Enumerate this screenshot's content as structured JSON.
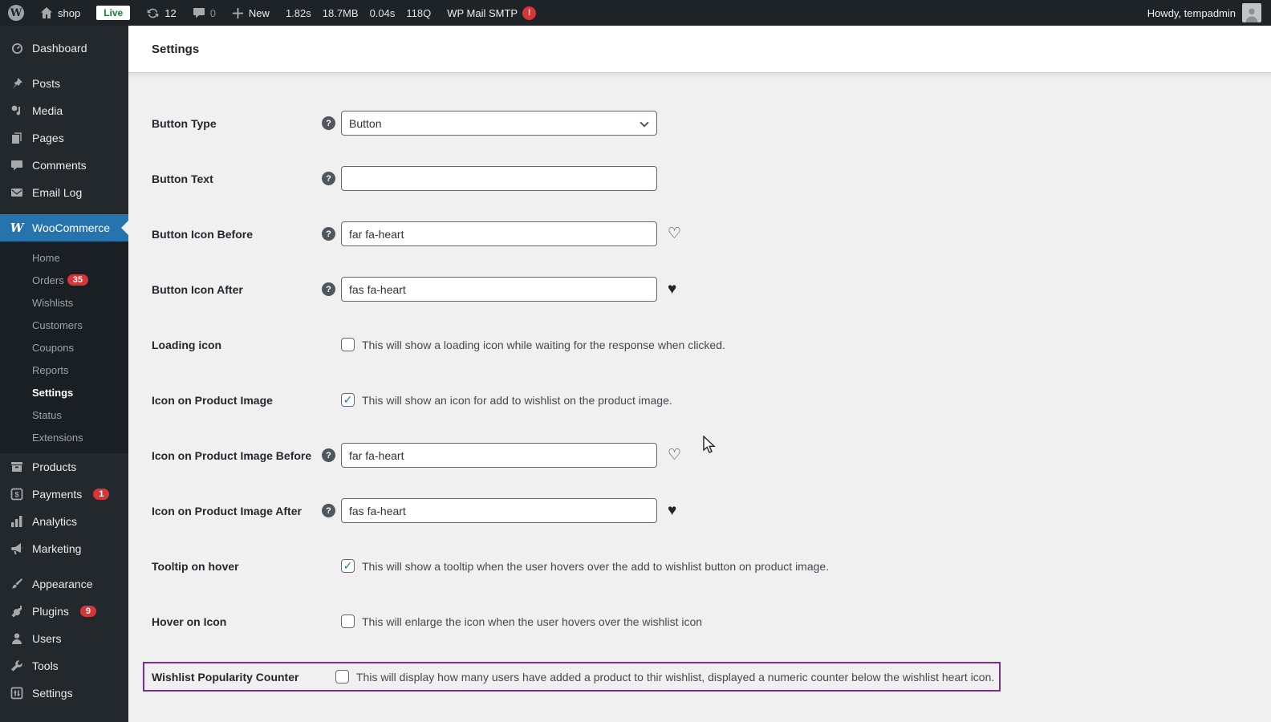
{
  "admin_bar": {
    "site_name": "shop",
    "live_badge": "Live",
    "updates_count": "12",
    "comments_count": "0",
    "new_label": "New",
    "stats": [
      "1.82s",
      "18.7MB",
      "0.04s",
      "118Q"
    ],
    "smtp_label": "WP Mail SMTP",
    "smtp_badge": "!",
    "howdy": "Howdy, tempadmin"
  },
  "sidebar": {
    "top": [
      {
        "label": "Dashboard"
      },
      {
        "label": "Posts"
      },
      {
        "label": "Media"
      },
      {
        "label": "Pages"
      },
      {
        "label": "Comments"
      },
      {
        "label": "Email Log"
      }
    ],
    "woocommerce": {
      "label": "WooCommerce",
      "w": "W"
    },
    "submenu": [
      {
        "label": "Home"
      },
      {
        "label": "Orders",
        "badge": "35"
      },
      {
        "label": "Wishlists"
      },
      {
        "label": "Customers"
      },
      {
        "label": "Coupons"
      },
      {
        "label": "Reports"
      },
      {
        "label": "Settings"
      },
      {
        "label": "Status"
      },
      {
        "label": "Extensions"
      }
    ],
    "bottom": [
      {
        "label": "Products"
      },
      {
        "label": "Payments",
        "badge": "1"
      },
      {
        "label": "Analytics"
      },
      {
        "label": "Marketing"
      },
      {
        "label": "Appearance"
      },
      {
        "label": "Plugins",
        "badge": "9"
      },
      {
        "label": "Users"
      },
      {
        "label": "Tools"
      },
      {
        "label": "Settings"
      }
    ]
  },
  "page": {
    "title": "Settings"
  },
  "icons": {
    "check": "✓",
    "heart_outline": "♡",
    "heart_solid": "♥",
    "help": "?"
  },
  "form": {
    "rows": [
      {
        "label": "Button Type",
        "type": "select",
        "value": "Button"
      },
      {
        "label": "Button Text",
        "type": "input",
        "value": ""
      },
      {
        "label": "Button Icon Before",
        "type": "input",
        "value": "far fa-heart"
      },
      {
        "label": "Button Icon After",
        "type": "input",
        "value": "fas fa-heart"
      },
      {
        "label": "Loading icon",
        "type": "checkbox",
        "checked": false,
        "desc": "This will show a loading icon while waiting for the response when clicked."
      },
      {
        "label": "Icon on Product Image",
        "type": "checkbox",
        "checked": true,
        "desc": "This will show an icon for add to wishlist on the product image."
      },
      {
        "label": "Icon on Product Image Before",
        "type": "input",
        "value": "far fa-heart"
      },
      {
        "label": "Icon on Product Image After",
        "type": "input",
        "value": "fas fa-heart"
      },
      {
        "label": "Tooltip on hover",
        "type": "checkbox",
        "checked": true,
        "desc": "This will show a tooltip when the user hovers over the add to wishlist button on product image."
      },
      {
        "label": "Hover on Icon",
        "type": "checkbox",
        "checked": false,
        "desc": "This will enlarge the icon when the user hovers over the wishlist icon"
      },
      {
        "label": "Wishlist Popularity Counter",
        "type": "checkbox",
        "checked": false,
        "desc": "This will display how many users have added a product to thir wishlist, displayed a numeric counter below the wishlist heart icon."
      }
    ]
  }
}
